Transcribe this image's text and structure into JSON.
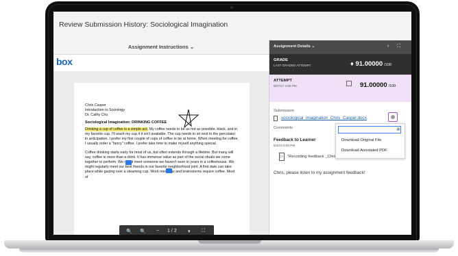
{
  "window": {
    "title": "Review Submission History: Sociological Imagination"
  },
  "left": {
    "instructions_label": "Assignment Instructions ⌄",
    "box_logo": "box",
    "document": {
      "author": "Chris Casper",
      "course": "Introduction to Sociology",
      "instructor": "Dr. Cathy Chu",
      "heading": "Sociological Imagination: DRINKING COFFEE",
      "highlighted": "Drinking a cup of coffee is a simple act.",
      "p1_rest": " My coffee needs to be as hot as possible, black, and in my favorite cup. I'll wash my cup if it isn't available. The cup needs to sit next to the percolator in anticipation. I prefer my first couple of cups of coffee to be at home. When meeting for coffee, I usually order a \"fancy\" coffee. I prefer take time to make myself anything special.",
      "p2": "Coffee drinking starts early for most of us, but often extends through a lifetime. But many will say, coffee is more than a drink. It has immense value as part of the social rituals we come together to perform. We might meet someone we haven't seen in years in a coffeehouse. We might regularly meet our best friends in our favorite neighborhood joint. A first date can take place while gazing over a steaming cup. Work meetings and brainstorms require coffee. Most of"
    },
    "toolbar": {
      "zoom_out": "🔍",
      "zoom_in": "🔍",
      "prev": "−",
      "page": "1 / 2",
      "next": "▾",
      "fullscreen": "⛶"
    }
  },
  "right": {
    "header": {
      "label": "Assignment Details ⌄",
      "collapse": "›",
      "expand": "⛶"
    },
    "grade": {
      "label": "GRADE",
      "sub": "LAST GRADED ATTEMPT",
      "value": "91.00000",
      "max": "/100",
      "lock": "♦"
    },
    "attempt": {
      "label": "ATTEMPT",
      "date": "9/27/17 1:05 PM",
      "value": "91.00000",
      "max": "/100"
    },
    "submission": {
      "label": "Submission",
      "file": "sociological_imagination_Chris_Casper.docx"
    },
    "dropdown": {
      "clear": "⊗",
      "items": [
        "Download Original File",
        "Download Annotated PDF"
      ]
    },
    "comments": {
      "label": "Comments",
      "feedback_label": "Feedback to Learner",
      "feedback_date": "5/4/18 8:00 PM",
      "recording": "\"Recording feedback _Chris\" Thanks",
      "message": "Chris, please listen to my assignment feedback!"
    }
  },
  "colors": {
    "accent": "#1a5fb4",
    "attempt_bg": "#f1e1f6",
    "highlight": "#f5e97a",
    "dark_panel": "#2f2f2f"
  }
}
